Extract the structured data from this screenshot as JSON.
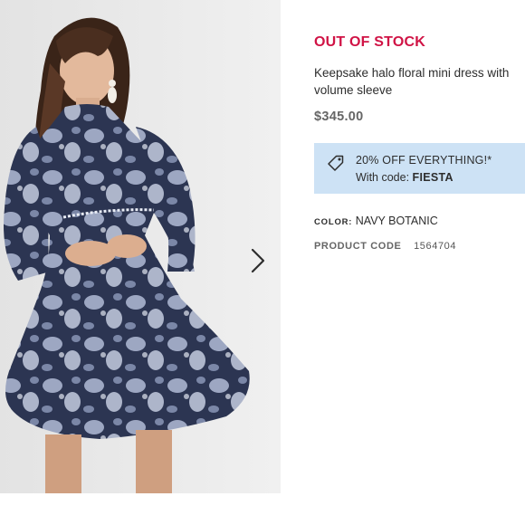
{
  "product": {
    "stock_status": "OUT OF STOCK",
    "title": "Keepsake halo floral mini dress with volume sleeve",
    "price": "$345.00",
    "promo": {
      "headline": "20% OFF EVERYTHING!*",
      "code_prefix": "With code:",
      "code": "FIESTA",
      "icon": "tag-icon"
    },
    "color_label": "COLOR:",
    "color_value": "NAVY BOTANIC",
    "product_code_label": "PRODUCT CODE",
    "product_code_value": "1564704",
    "gallery_next_icon": "chevron-right-icon"
  },
  "colors": {
    "stock_status": "#d01345",
    "promo_background": "#cde2f5",
    "dress_navy": "#2c3552",
    "dress_print": "#aab4cf"
  }
}
